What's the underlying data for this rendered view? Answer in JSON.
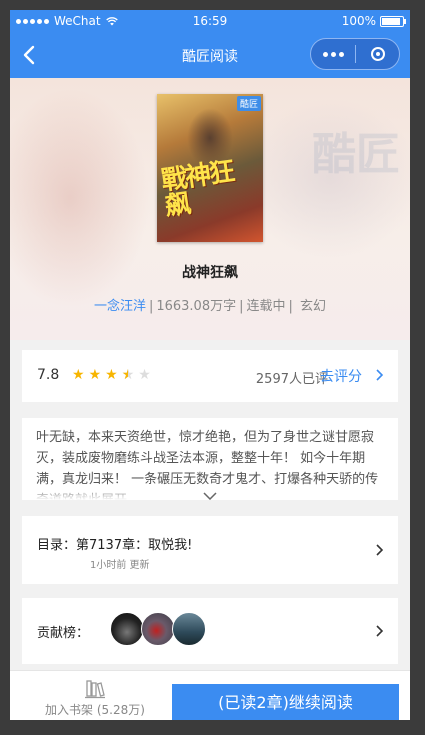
{
  "statusbar": {
    "carrier": "WeChat",
    "time": "16:59",
    "battery": "100%",
    "battery_level": 1.0
  },
  "navbar": {
    "title": "酷匠阅读"
  },
  "hero": {
    "watermark": "酷匠",
    "cover_badge": "酷匠",
    "cover_title": "戰神狂飙"
  },
  "book": {
    "title": "战神狂飙",
    "author": "一念汪洋",
    "word_count": "1663.08万字",
    "status": "连载中",
    "genre": "玄幻"
  },
  "rating": {
    "score": "7.8",
    "stars": 3.5,
    "count": "2597人已评",
    "rate_label": "去评分"
  },
  "description": {
    "text": "叶无缺，本来天资绝世，惊才绝艳，但为了身世之谜甘愿寂灭，装成废物磨练斗战圣法本源，整整十年！ 如今十年期满，真龙归来！ 一条碾压无数奇才鬼才、打爆各种天骄的传奇道路就此展开……"
  },
  "catalog": {
    "latest": "目录：第7137章：取悦我!",
    "updated": "1小时前 更新"
  },
  "contributors": {
    "label": "贡献榜："
  },
  "bottom": {
    "shelf_label": "加入书架 (5.28万)",
    "read_label": "(已读2章)继续阅读"
  },
  "colors": {
    "accent": "#3b8cf1",
    "star": "#f7b500"
  }
}
